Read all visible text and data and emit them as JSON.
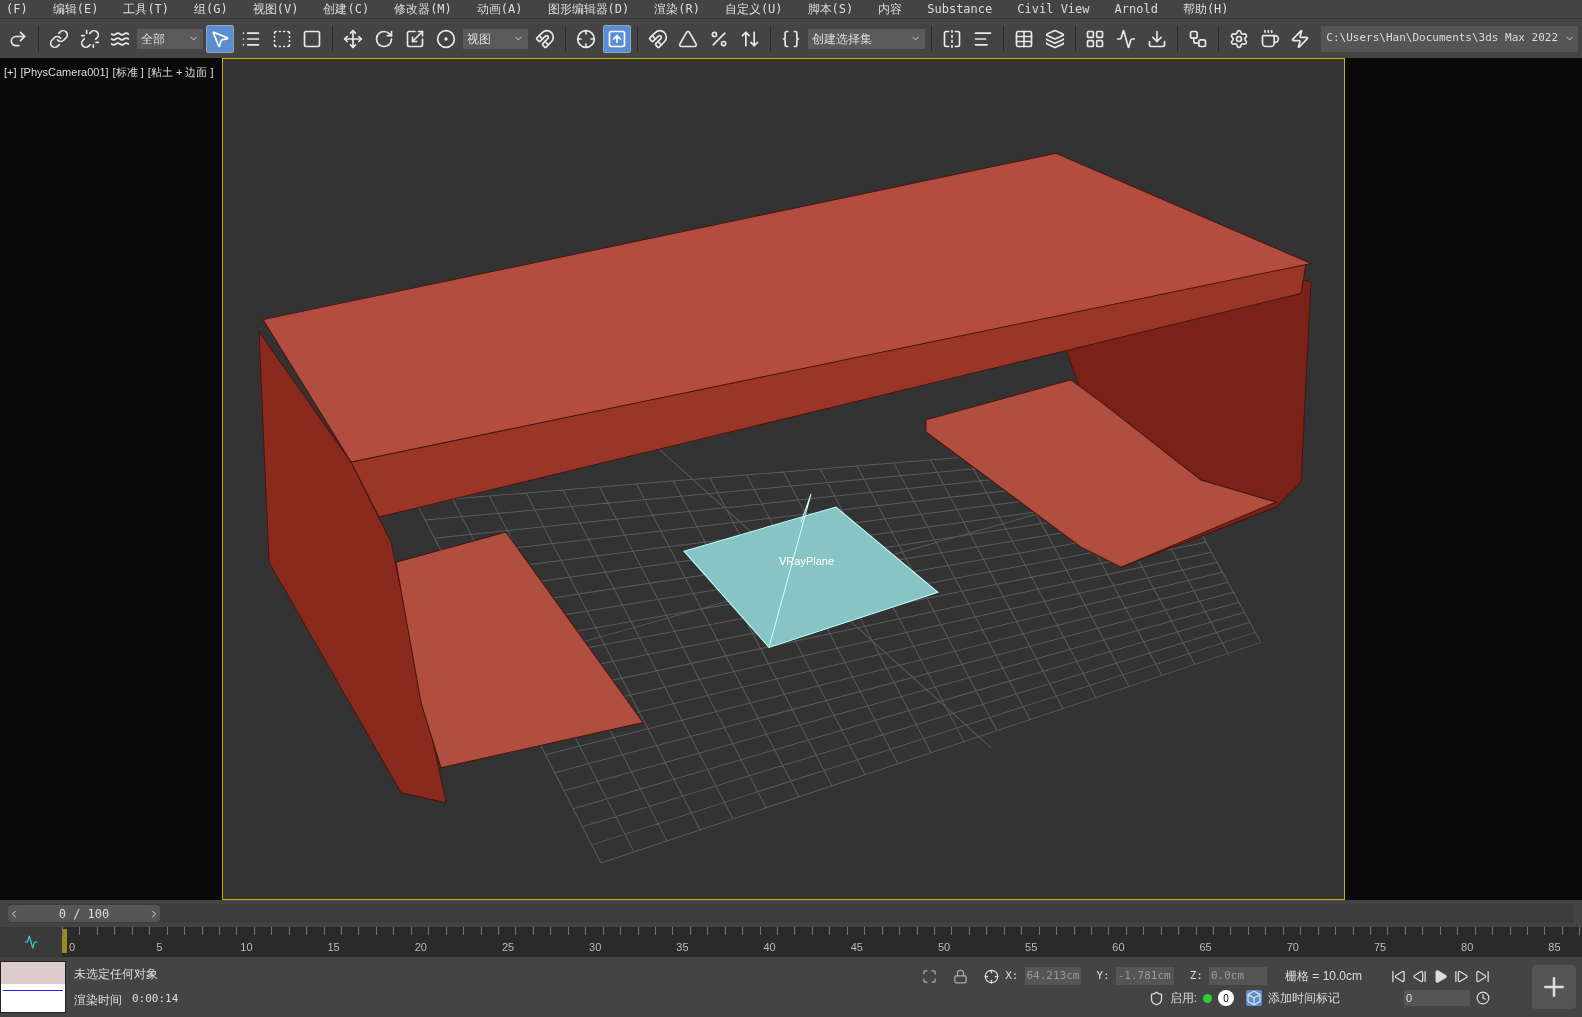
{
  "menu": [
    "(F)",
    "编辑(E)",
    "工具(T)",
    "组(G)",
    "视图(V)",
    "创建(C)",
    "修改器(M)",
    "动画(A)",
    "图形编辑器(D)",
    "渲染(R)",
    "自定义(U)",
    "脚本(S)",
    "内容",
    "Substance",
    "Civil View",
    "Arnold",
    "帮助(H)"
  ],
  "toolbar": [
    {
      "kind": "button",
      "selected": false
    },
    {
      "kind": "sep"
    },
    {
      "kind": "button",
      "selected": false
    },
    {
      "kind": "button",
      "selected": false
    },
    {
      "kind": "button",
      "selected": false
    },
    {
      "kind": "dropdown",
      "label": "全部"
    },
    {
      "kind": "button",
      "selected": true
    },
    {
      "kind": "button",
      "selected": false
    },
    {
      "kind": "button",
      "selected": false
    },
    {
      "kind": "button",
      "selected": false
    },
    {
      "kind": "sep"
    },
    {
      "kind": "button",
      "selected": false
    },
    {
      "kind": "button",
      "selected": false
    },
    {
      "kind": "button",
      "selected": false
    },
    {
      "kind": "button",
      "selected": false
    },
    {
      "kind": "dropdown",
      "label": "视图"
    },
    {
      "kind": "button",
      "selected": false
    },
    {
      "kind": "sep"
    },
    {
      "kind": "button",
      "selected": false
    },
    {
      "kind": "button",
      "selected": true
    },
    {
      "kind": "sep"
    },
    {
      "kind": "button",
      "selected": false
    },
    {
      "kind": "button",
      "selected": false
    },
    {
      "kind": "button",
      "selected": false
    },
    {
      "kind": "button",
      "selected": false
    },
    {
      "kind": "sep"
    },
    {
      "kind": "button",
      "selected": false
    },
    {
      "kind": "dropdown",
      "label": "创建选择集"
    },
    {
      "kind": "sep"
    },
    {
      "kind": "button",
      "selected": false
    },
    {
      "kind": "button",
      "selected": false
    },
    {
      "kind": "sep"
    },
    {
      "kind": "button",
      "selected": false
    },
    {
      "kind": "button",
      "selected": false
    },
    {
      "kind": "sep"
    },
    {
      "kind": "button",
      "selected": false
    },
    {
      "kind": "button",
      "selected": false
    },
    {
      "kind": "button",
      "selected": false
    },
    {
      "kind": "sep"
    },
    {
      "kind": "button",
      "selected": false
    },
    {
      "kind": "sep"
    },
    {
      "kind": "button",
      "selected": false
    },
    {
      "kind": "button",
      "selected": false
    },
    {
      "kind": "button",
      "selected": false
    },
    {
      "kind": "path",
      "label": "C:\\Users\\Han\\Documents\\3ds Max 2022"
    }
  ],
  "viewport": {
    "labels": [
      "[+]",
      "[PhysCamera001]",
      "[标准 ]",
      "[粘土 + 边面 ]"
    ],
    "object_label": "VRayPlane"
  },
  "timeline": {
    "slider": "0 / 100",
    "level": 0,
    "ticks": [
      "0",
      "5",
      "10",
      "15",
      "20",
      "25",
      "30",
      "35",
      "40",
      "45",
      "50",
      "55",
      "60",
      "65",
      "70",
      "75",
      "80",
      "85"
    ]
  },
  "status": {
    "selection": "未选定任何对象",
    "render_label": "渲染时间",
    "render_time": "0:00:14",
    "x_label": "X:",
    "x": "64.213cm",
    "y_label": "Y:",
    "y": "-1.781cm",
    "z_label": "Z:",
    "z": "0.0cm",
    "grid": "栅格 = 10.0cm",
    "enable": "启用:",
    "key_count": "0",
    "add_marker": "添加时间标记",
    "frame": "0"
  }
}
